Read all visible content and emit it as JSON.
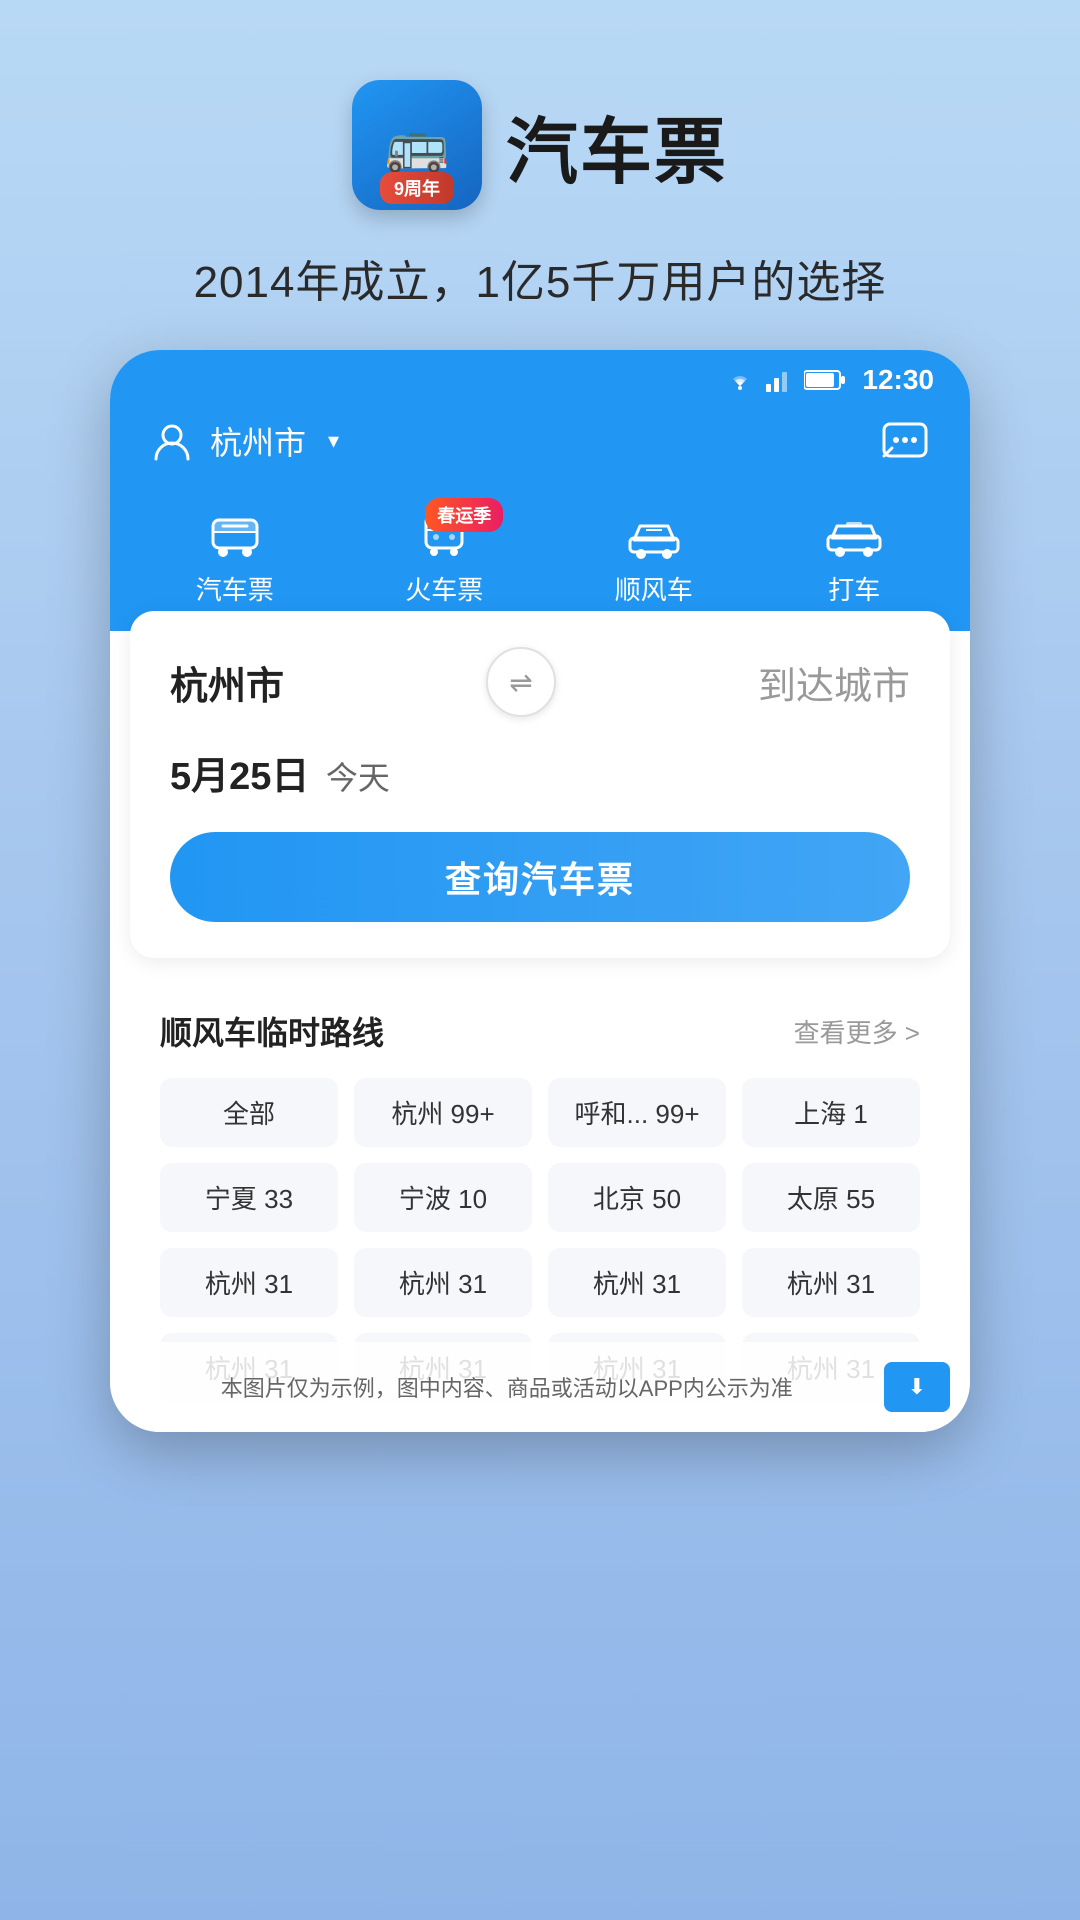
{
  "app": {
    "icon_label": "汽车票",
    "anniversary": "9周年",
    "title": "汽车票",
    "subtitle": "2014年成立，1亿5千万用户的选择"
  },
  "status_bar": {
    "time": "12:30"
  },
  "phone": {
    "location": "杭州市",
    "location_arrow": "∨",
    "nav_tabs": [
      {
        "label": "汽车票",
        "icon": "🚌",
        "badge": null
      },
      {
        "label": "火车票",
        "icon": "🚆",
        "badge": "春运季"
      },
      {
        "label": "顺风车",
        "icon": "🚗",
        "badge": null
      },
      {
        "label": "打车",
        "icon": "🚕",
        "badge": null
      }
    ],
    "search": {
      "from": "杭州市",
      "to_placeholder": "到达城市",
      "date": "5月25日",
      "today": "今天",
      "button": "查询汽车票"
    },
    "rideshare": {
      "title": "顺风车临时路线",
      "view_more": "查看更多 >",
      "tags": [
        "全部",
        "杭州 99+",
        "呼和... 99+",
        "上海 1",
        "宁夏 33",
        "宁波 10",
        "北京 50",
        "太原 55",
        "杭州 31",
        "杭州 31",
        "杭州 31",
        "杭州 31",
        "杭州 31",
        "杭州 31",
        "杭州 31",
        "杭州 31"
      ]
    },
    "bottom_notice": "本图片仅为示例，图中内容、商品或活动以APP内公示为准"
  }
}
